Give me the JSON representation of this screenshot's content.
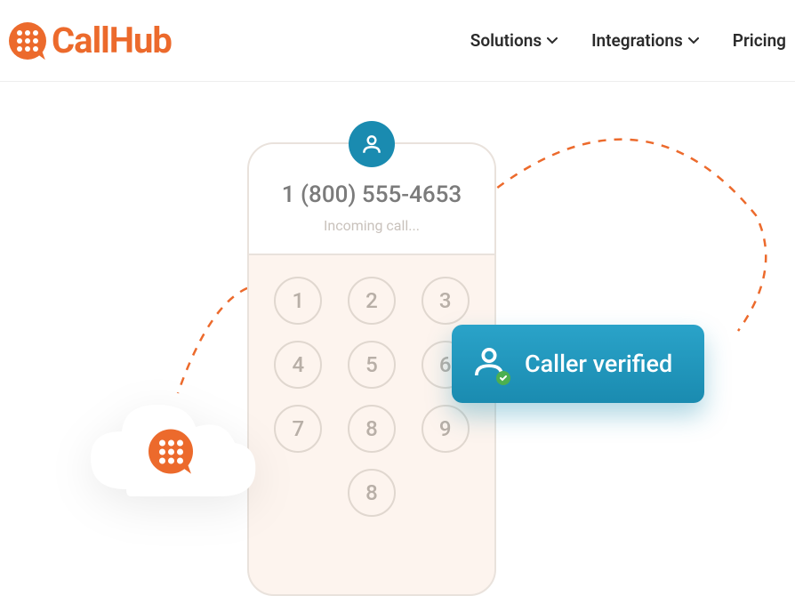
{
  "brand": {
    "name": "CallHub",
    "color": "#ec6a2c"
  },
  "nav": {
    "items": [
      {
        "label": "Solutions",
        "dropdown": true
      },
      {
        "label": "Integrations",
        "dropdown": true
      },
      {
        "label": "Pricing",
        "dropdown": false
      }
    ]
  },
  "phone": {
    "number": "1 (800) 555-4653",
    "status": "Incoming call...",
    "keys": [
      "1",
      "2",
      "3",
      "4",
      "5",
      "6",
      "7",
      "8",
      "9",
      "8"
    ]
  },
  "badge": {
    "text": "Caller verified"
  },
  "colors": {
    "teal": "#1a8bb0",
    "green": "#4caf50"
  }
}
